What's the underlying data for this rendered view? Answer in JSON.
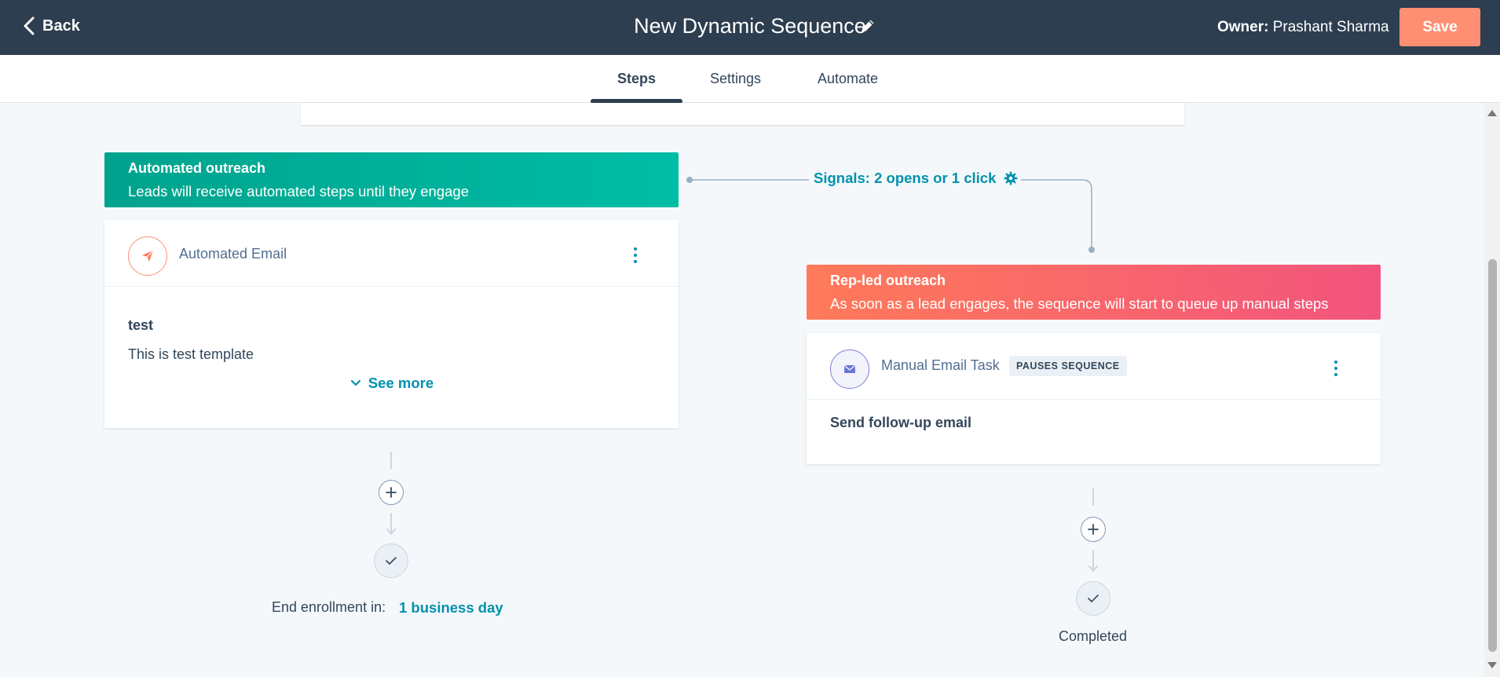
{
  "header": {
    "back_label": "Back",
    "title": "New Dynamic Sequence",
    "owner_label": "Owner:",
    "owner_name": "Prashant Sharma",
    "save_label": "Save"
  },
  "tabs": [
    {
      "label": "Steps",
      "active": true
    },
    {
      "label": "Settings",
      "active": false
    },
    {
      "label": "Automate",
      "active": false
    }
  ],
  "automated": {
    "title": "Automated outreach",
    "description": "Leads will receive automated steps until they engage",
    "step": {
      "type": "Automated Email",
      "name": "test",
      "preview": "This is test template",
      "see_more": "See more"
    },
    "end_label": "End enrollment in:",
    "end_value": "1 business day"
  },
  "signals": {
    "label": "Signals: 2 opens or 1 click"
  },
  "rep_led": {
    "title": "Rep-led outreach",
    "description": "As soon as a lead engages, the sequence will start to queue up manual steps",
    "step": {
      "type": "Manual Email Task",
      "badge": "PAUSES SEQUENCE",
      "name": "Send follow-up email"
    },
    "end_label": "Completed"
  },
  "colors": {
    "header_bg": "#2d3e50",
    "save_bg": "#ff8f73",
    "teal": "#00bda5",
    "coral": "#ff7a59",
    "link": "#0091ae"
  }
}
